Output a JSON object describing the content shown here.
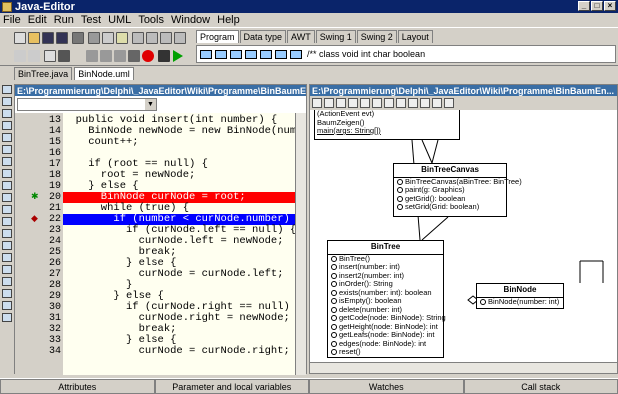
{
  "window": {
    "title": "Java-Editor"
  },
  "menu": [
    "File",
    "Edit",
    "Run",
    "Test",
    "UML",
    "Tools",
    "Window",
    "Help"
  ],
  "palette": {
    "tabs": [
      "Program",
      "Data type",
      "AWT",
      "Swing 1",
      "Swing 2",
      "Layout"
    ],
    "keywords": "/** class  void  int  char  boolean"
  },
  "files": [
    "BinTree.java",
    "BinNode.uml"
  ],
  "editor": {
    "path": "E:\\Programmierung\\Delphi\\_JavaEditor\\Wiki\\Programme\\BinBaumEn...",
    "lines": [
      {
        "n": "13",
        "t": "  public void insert(int number) {"
      },
      {
        "n": "14",
        "t": "    BinNode newNode = new BinNode(number);"
      },
      {
        "n": "15",
        "t": "    count++;"
      },
      {
        "n": "16",
        "t": ""
      },
      {
        "n": "17",
        "t": "    if (root == null) {"
      },
      {
        "n": "18",
        "t": "      root = newNode;"
      },
      {
        "n": "19",
        "t": "    } else {"
      },
      {
        "n": "20",
        "t": "      BinNode curNode = root;"
      },
      {
        "n": "21",
        "t": "      while (true) {"
      },
      {
        "n": "22",
        "t": "        if (number < curNode.number) {"
      },
      {
        "n": "23",
        "t": "          if (curNode.left == null) {"
      },
      {
        "n": "24",
        "t": "            curNode.left = newNode;"
      },
      {
        "n": "25",
        "t": "            break;"
      },
      {
        "n": "26",
        "t": "          } else {"
      },
      {
        "n": "27",
        "t": "            curNode = curNode.left;"
      },
      {
        "n": "28",
        "t": "          }"
      },
      {
        "n": "29",
        "t": "        } else {"
      },
      {
        "n": "30",
        "t": "          if (curNode.right == null) {"
      },
      {
        "n": "31",
        "t": "            curNode.right = newNode;"
      },
      {
        "n": "32",
        "t": "            break;"
      },
      {
        "n": "33",
        "t": "          } else {"
      },
      {
        "n": "34",
        "t": "            curNode = curNode.right;"
      }
    ]
  },
  "uml": {
    "path": "E:\\Programmierung\\Delphi\\_JavaEditor\\Wiki\\Programme\\BinBaumEn...",
    "top_box": [
      "(ActionEvent evt)",
      "BaumZeigen()",
      "main(args: String[])"
    ],
    "canvas": {
      "title": "BinTreeCanvas",
      "ops": [
        "BinTreeCanvas(aBinTree: BinTree)",
        "paint(g: Graphics)",
        "getGrid(): boolean",
        "setGrid(Grid: boolean)"
      ]
    },
    "bintree": {
      "title": "BinTree",
      "ops": [
        "BinTree()",
        "insert(number: int)",
        "insert2(number: int)",
        "inOrder(): String",
        "exists(number: int): boolean",
        "isEmpty(): boolean",
        "delete(number: int)",
        "getCode(node: BinNode): String",
        "getHeight(node: BinNode): int",
        "getLeafs(node: BinNode): int",
        "edges(node: BinNode): int",
        "reset()"
      ]
    },
    "binnode": {
      "title": "BinNode",
      "ops": [
        "BinNode(number: int)"
      ]
    }
  },
  "status": [
    "Attributes",
    "Parameter and local variables",
    "Watches",
    "Call stack"
  ]
}
